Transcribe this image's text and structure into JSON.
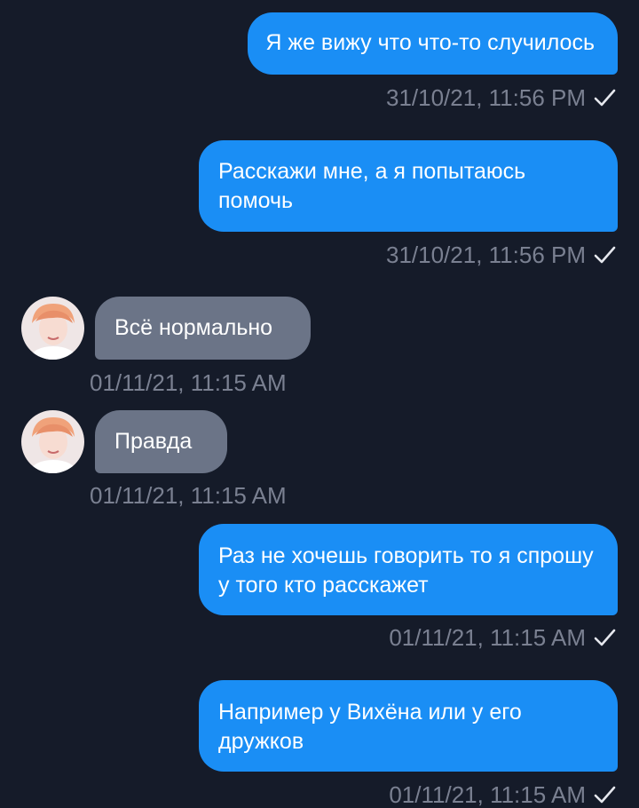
{
  "messages": [
    {
      "text": "Я же вижу что что-то случилось",
      "time": "31/10/21, 11:56 PM",
      "direction": "outgoing"
    },
    {
      "text": "Расскажи мне, а я попытаюсь помочь",
      "time": "31/10/21, 11:56 PM",
      "direction": "outgoing"
    },
    {
      "text": "Всё нормально",
      "time": "01/11/21, 11:15 AM",
      "direction": "incoming"
    },
    {
      "text": "Правда",
      "time": "01/11/21, 11:15 AM",
      "direction": "incoming"
    },
    {
      "text": "Раз не хочешь говорить то я спрошу у того кто расскажет",
      "time": "01/11/21, 11:15 AM",
      "direction": "outgoing"
    },
    {
      "text": "Например у Вихёна или у его дружков",
      "time": "01/11/21, 11:15 AM",
      "direction": "outgoing"
    }
  ],
  "colors": {
    "background": "#151b29",
    "outgoing_bubble": "#1a8ef5",
    "incoming_bubble": "#6b7487",
    "timestamp": "#7a8091"
  },
  "icons": {
    "read_receipt": "check-icon",
    "sender_avatar": "avatar"
  }
}
